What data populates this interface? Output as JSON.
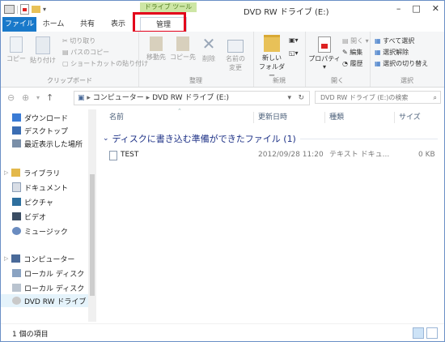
{
  "window": {
    "title": "DVD RW ドライブ (E:)",
    "contextual_tab_group": "ドライブ ツール"
  },
  "tabs": [
    {
      "label": "ファイル"
    },
    {
      "label": "ホーム"
    },
    {
      "label": "共有"
    },
    {
      "label": "表示"
    },
    {
      "label": "管理"
    }
  ],
  "ribbon": {
    "clipboard": {
      "label": "クリップボード",
      "copy": "コピー",
      "paste": "貼り付け",
      "cut": "切り取り",
      "copy_path": "パスのコピー",
      "paste_shortcut": "ショートカットの貼り付け"
    },
    "organize": {
      "label": "整理",
      "move_to": "移動先",
      "copy_to": "コピー先",
      "delete": "削除",
      "rename_l1": "名前の",
      "rename_l2": "変更"
    },
    "new": {
      "label": "新規",
      "new_folder_l1": "新しい",
      "new_folder_l2": "フォルダー"
    },
    "open": {
      "label": "開く",
      "properties": "プロパティ",
      "open": "開く",
      "edit": "編集",
      "history": "履歴"
    },
    "select": {
      "label": "選択",
      "select_all": "すべて選択",
      "select_none": "選択解除",
      "invert": "選択の切り替え"
    }
  },
  "address": {
    "path": [
      "コンピューター",
      "DVD RW ドライブ (E:)"
    ],
    "search_placeholder": "DVD RW ドライブ (E:)の検索"
  },
  "navpane": {
    "favorites": [
      "ダウンロード",
      "デスクトップ",
      "最近表示した場所"
    ],
    "libraries_header": "ライブラリ",
    "libraries": [
      "ドキュメント",
      "ピクチャ",
      "ビデオ",
      "ミュージック"
    ],
    "computer_header": "コンピューター",
    "computer": [
      "ローカル ディスク",
      "ローカル ディスク",
      "DVD RW ドライブ"
    ]
  },
  "columns": [
    "名前",
    "更新日時",
    "種類",
    "サイズ"
  ],
  "group": {
    "label": "ディスクに書き込む準備ができたファイル (1)"
  },
  "files": [
    {
      "name": "TEST",
      "modified": "2012/09/28 11:20",
      "type": "テキスト ドキュ...",
      "size": "0 KB"
    }
  ],
  "status": {
    "count": "1 個の項目"
  },
  "colors": {
    "file_tab": "#1979ca",
    "context_tab": "#cde6a5",
    "highlight": "#e3001b",
    "selection": "#e5f3fb",
    "group_text": "#1e3287"
  }
}
